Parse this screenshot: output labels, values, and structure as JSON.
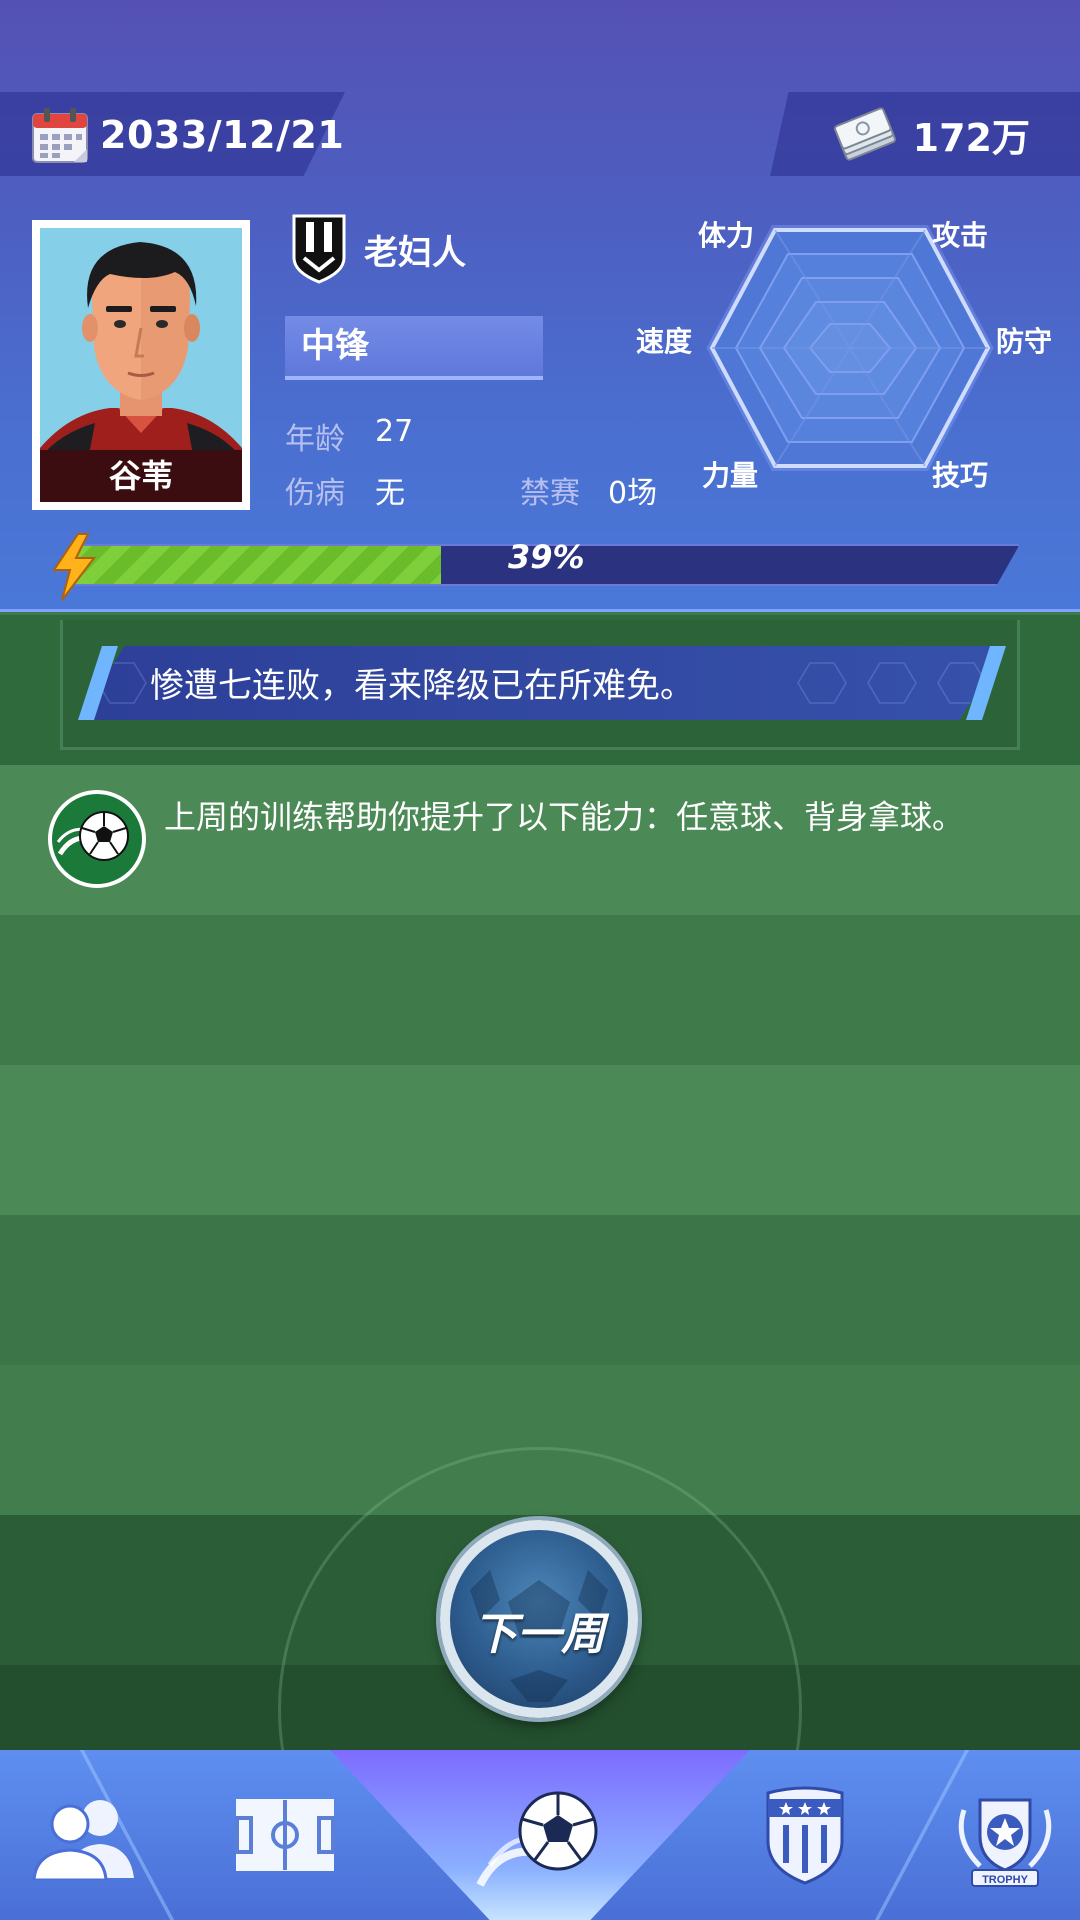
{
  "header": {
    "date": "2033/12/21",
    "money": "172万"
  },
  "player": {
    "name": "谷苇",
    "team": "老妇人",
    "position": "中锋",
    "age_label": "年龄",
    "age": "27",
    "injury_label": "伤病",
    "injury": "无",
    "suspension_label": "禁赛",
    "suspension": "0场"
  },
  "radar": {
    "stamina": "体力",
    "attack": "攻击",
    "speed": "速度",
    "defense": "防守",
    "strength": "力量",
    "technique": "技巧"
  },
  "progress": {
    "value": 0.39,
    "label": "39%"
  },
  "news": {
    "headline": "惨遭七连败，看来降级已在所难免。",
    "training_message": "上周的训练帮助你提升了以下能力：任意球、背身拿球。"
  },
  "actions": {
    "next_week": "下一周"
  },
  "nav": {
    "items": [
      {
        "icon": "players-icon"
      },
      {
        "icon": "pitch-icon"
      },
      {
        "icon": "match-ball-icon",
        "active": true
      },
      {
        "icon": "club-badge-icon"
      },
      {
        "icon": "trophy-icon",
        "label": "TROPHY"
      }
    ]
  },
  "colors": {
    "header_blue": "#4d5fc1",
    "pitch_green": "#3f7a4c",
    "progress_green": "#7fcf3a",
    "nav_blue": "#5e8ff0"
  }
}
